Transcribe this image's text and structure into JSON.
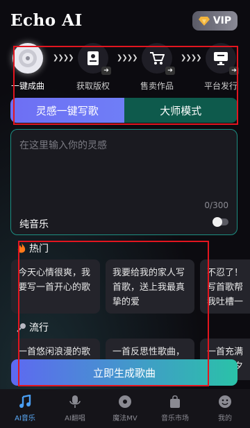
{
  "header": {
    "title": "Echo AI",
    "vip_label": "VIP"
  },
  "steps": [
    {
      "label": "一键成曲",
      "icon": "disc-icon",
      "active": true
    },
    {
      "label": "获取版权",
      "icon": "certificate-icon",
      "active": false
    },
    {
      "label": "售卖作品",
      "icon": "cart-icon",
      "active": false
    },
    {
      "label": "平台发行",
      "icon": "monitor-icon",
      "active": false
    }
  ],
  "mode_tabs": [
    "灵感一键写歌",
    "大师模式"
  ],
  "inspiration": {
    "placeholder": "在这里输入你的灵感",
    "counter": "0/300",
    "pure_music_label": "纯音乐"
  },
  "hot": {
    "title": "热门",
    "chips": [
      "今天心情很爽，我要写一首开心的歌",
      "我要给我的家人写首歌，送上我最真挚的爱",
      "不忍了！写首歌帮我吐槽一"
    ]
  },
  "trending": {
    "title": "流行",
    "chips": [
      "一首悠闲浪漫的歌",
      "一首反思性歌曲，",
      "一首充满活力，夕"
    ]
  },
  "generate_label": "立即生成歌曲",
  "tabbar": [
    {
      "label": "AI音乐",
      "icon": "music-note-icon",
      "active": true
    },
    {
      "label": "AI翻唱",
      "icon": "microphone-icon",
      "active": false
    },
    {
      "label": "魔法MV",
      "icon": "vinyl-icon",
      "active": false
    },
    {
      "label": "音乐市场",
      "icon": "shop-bag-icon",
      "active": false
    },
    {
      "label": "我的",
      "icon": "smiley-icon",
      "active": false
    }
  ],
  "colors": {
    "accent_blue": "#6e6ff3",
    "accent_green": "#2ac2a8",
    "annotation_red": "#e3151f"
  }
}
